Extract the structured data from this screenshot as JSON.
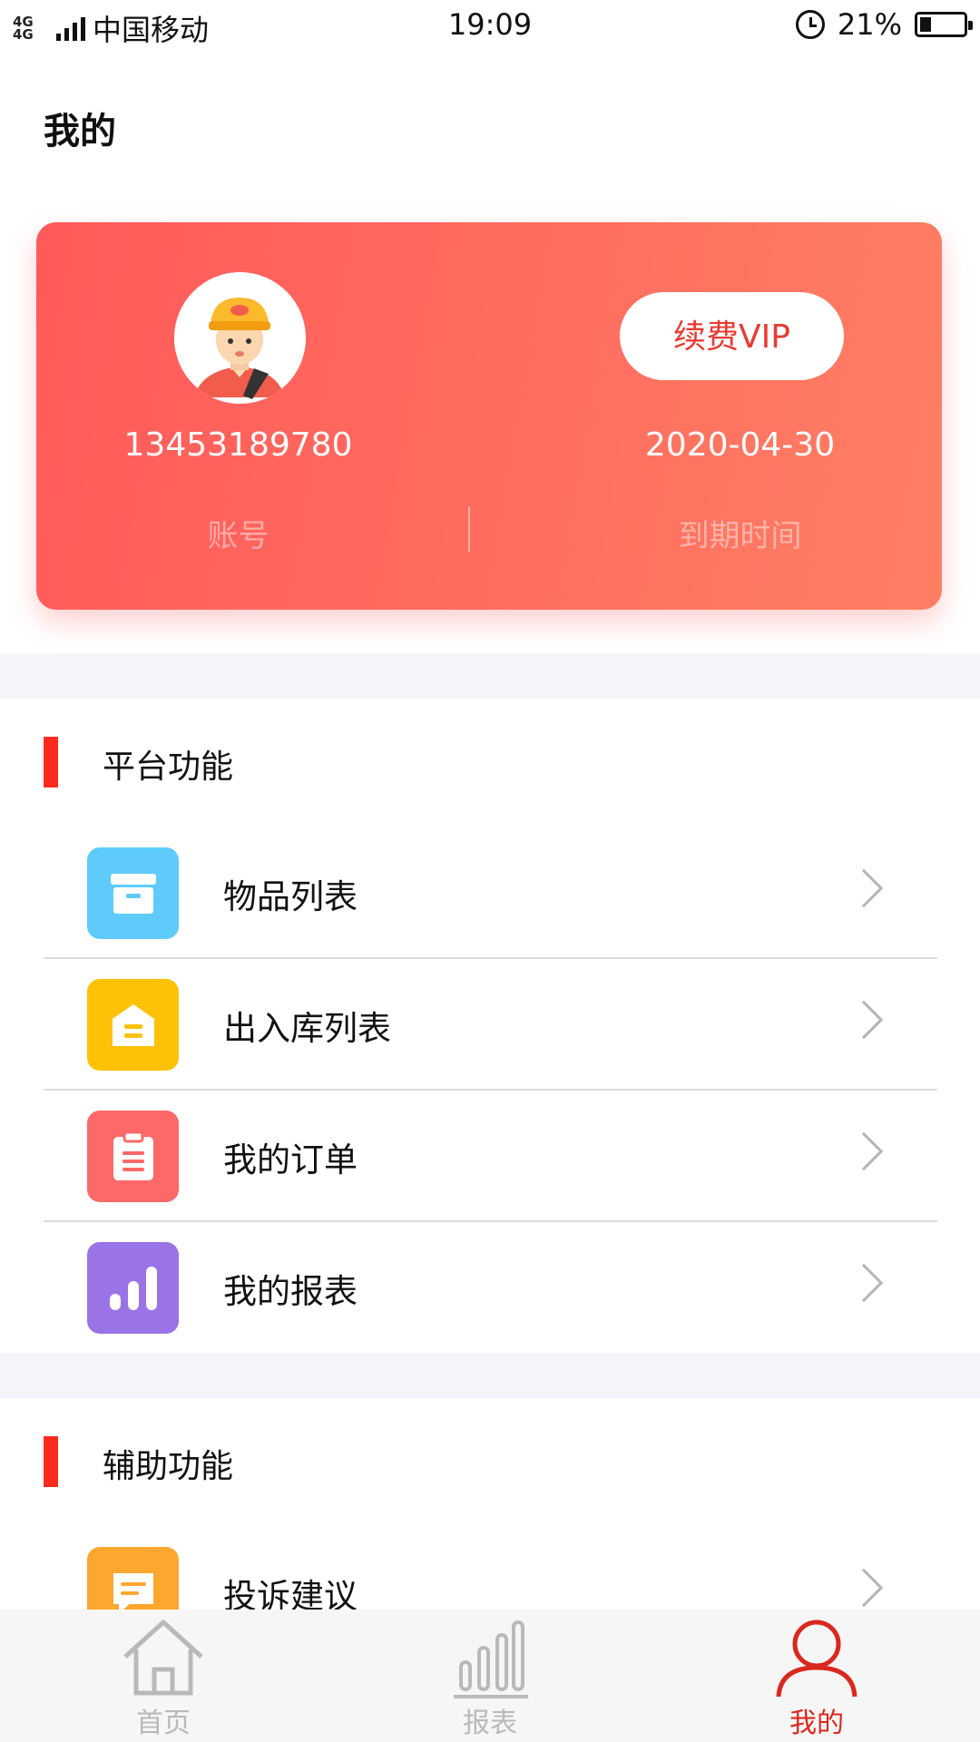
{
  "status_bar": {
    "network": "4G 4G",
    "carrier": "中国移动",
    "time": "19:09",
    "battery": "21%"
  },
  "header": {
    "title": "我的"
  },
  "profile": {
    "account_value": "13453189780",
    "account_label": "账号",
    "vip_button": "续费VIP",
    "expiry_value": "2020-04-30",
    "expiry_label": "到期时间"
  },
  "sections": [
    {
      "title": "平台功能",
      "items": [
        {
          "label": "物品列表",
          "icon": "archive-box-icon",
          "color": "#5ecbfa"
        },
        {
          "label": "出入库列表",
          "icon": "warehouse-icon",
          "color": "#fdc106"
        },
        {
          "label": "我的订单",
          "icon": "clipboard-icon",
          "color": "#fd6868"
        },
        {
          "label": "我的报表",
          "icon": "bar-chart-icon",
          "color": "#9a73e6"
        }
      ]
    },
    {
      "title": "辅助功能",
      "items": [
        {
          "label": "投诉建议",
          "icon": "feedback-icon",
          "color": "#fda72e"
        }
      ]
    }
  ],
  "tabbar": {
    "items": [
      {
        "label": "首页",
        "icon": "home-icon",
        "active": false
      },
      {
        "label": "报表",
        "icon": "bar-chart-icon",
        "active": false
      },
      {
        "label": "我的",
        "icon": "user-icon",
        "active": true
      }
    ]
  },
  "colors": {
    "accent": "#ff2a1e",
    "card_gradient_start": "#ff5a5a",
    "card_gradient_end": "#ff7f63",
    "vip_text": "#e83b32",
    "tab_active": "#d9281e",
    "tab_inactive": "#b9b9b9"
  }
}
